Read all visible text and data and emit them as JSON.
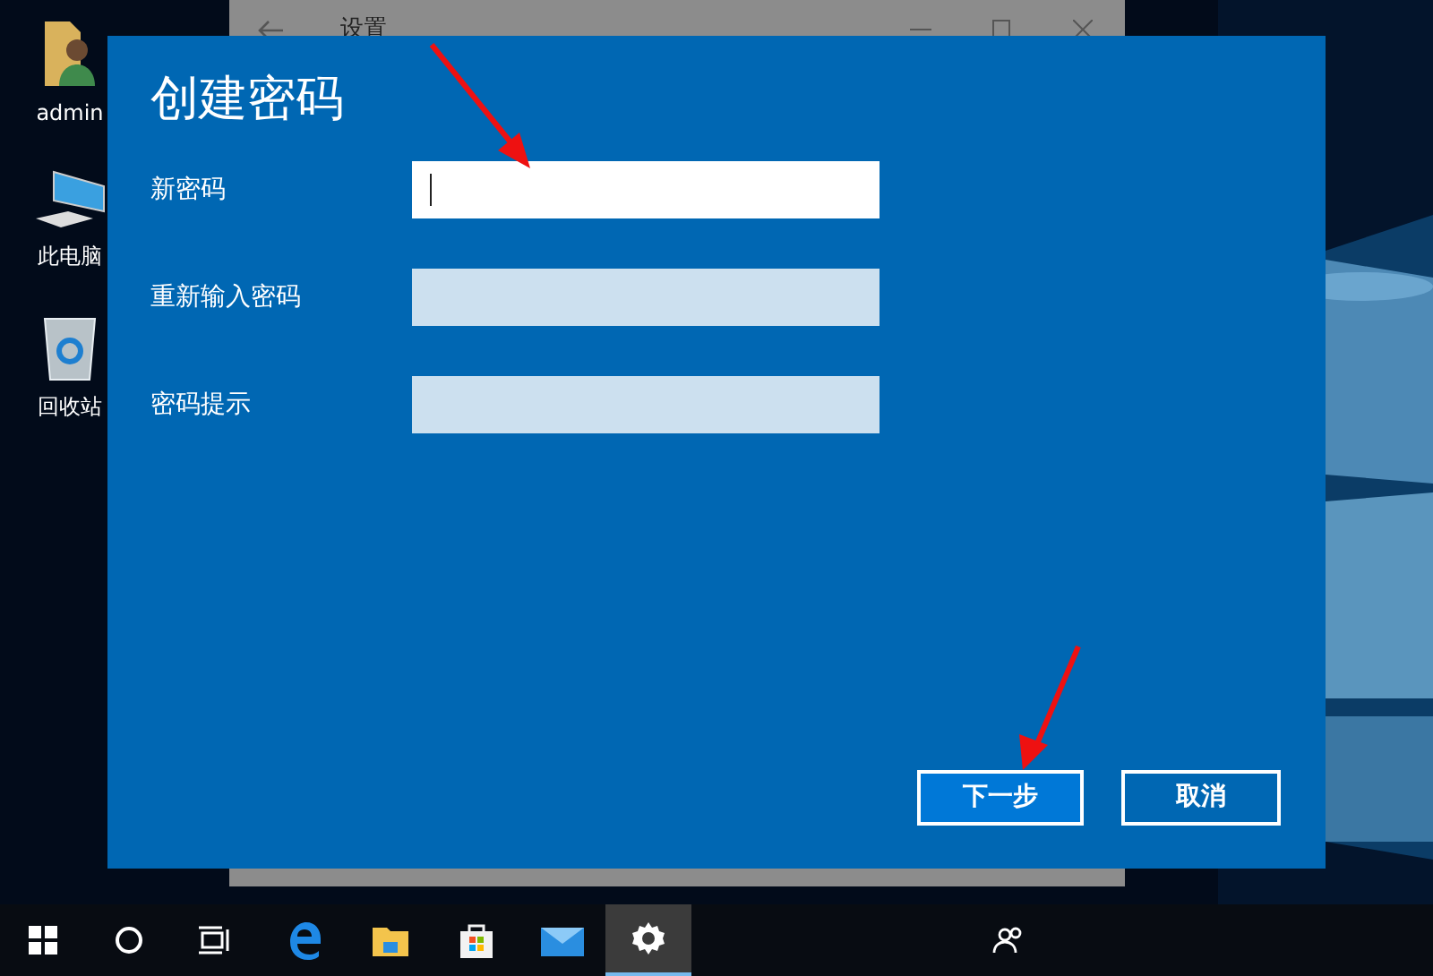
{
  "desktop_icons": [
    {
      "kind": "user",
      "label": "admin"
    },
    {
      "kind": "computer",
      "label": "此电脑"
    },
    {
      "kind": "recycle",
      "label": "回收站"
    }
  ],
  "background_window": {
    "title": "设置"
  },
  "dialog": {
    "title": "创建密码",
    "fields": [
      {
        "label": "新密码",
        "focused": true
      },
      {
        "label": "重新输入密码",
        "focused": false
      },
      {
        "label": "密码提示",
        "focused": false
      }
    ],
    "buttons": [
      {
        "label": "下一步",
        "default": true
      },
      {
        "label": "取消",
        "default": false
      }
    ]
  },
  "taskbar": [
    {
      "kind": "start",
      "active": false
    },
    {
      "kind": "search",
      "active": false
    },
    {
      "kind": "taskview",
      "active": false
    },
    {
      "kind": "edge",
      "active": false
    },
    {
      "kind": "explorer",
      "active": false
    },
    {
      "kind": "store",
      "active": false
    },
    {
      "kind": "mail",
      "active": false
    },
    {
      "kind": "settings",
      "active": true
    }
  ]
}
